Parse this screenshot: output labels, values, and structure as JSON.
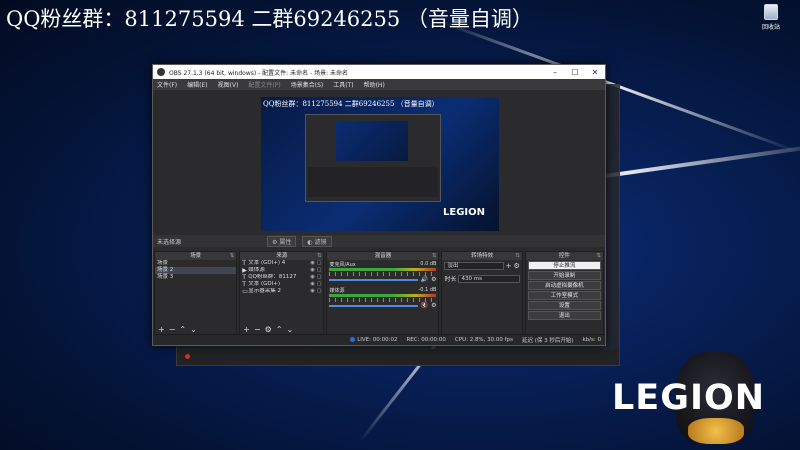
{
  "banner": {
    "text": "QQ粉丝群：811275594 二群69246255 （音量自调）"
  },
  "desktop": {
    "recycle_label": "回收站",
    "legion_logo": "LEGION"
  },
  "obs": {
    "title": "OBS 27.1.3 (64 bit, windows) - 配置文件: 未命名 - 场景: 未命名",
    "menu": [
      {
        "label": "文件(F)",
        "dim": false
      },
      {
        "label": "编辑(E)",
        "dim": false
      },
      {
        "label": "视图(V)",
        "dim": false
      },
      {
        "label": "配置文件(P)",
        "dim": true
      },
      {
        "label": "场景集合(S)",
        "dim": false
      },
      {
        "label": "工具(T)",
        "dim": false
      },
      {
        "label": "帮助(H)",
        "dim": false
      }
    ],
    "preview": {
      "text": "QQ粉丝群：811275594 二群69246255 （音量自调）",
      "logo": "LEGION"
    },
    "preview_toolbar": {
      "source_label": "未选择源",
      "props_label": "属性",
      "filters_label": "滤镜"
    },
    "scenes": {
      "header": "场景",
      "items": [
        "场景",
        "场景 2",
        "场景 3"
      ]
    },
    "sources": {
      "header": "来源",
      "items": [
        {
          "icon": "T",
          "label": "文本 (GDI+) 4"
        },
        {
          "icon": "▶",
          "label": "媒体源"
        },
        {
          "icon": "T",
          "label": "QQ粉丝群：81127"
        },
        {
          "icon": "T",
          "label": "文本 (GDI+)"
        },
        {
          "icon": "▭",
          "label": "显示器采集 2"
        }
      ]
    },
    "mixer": {
      "header": "混音器",
      "channels": [
        {
          "name": "麦克风/Aux",
          "db": "0.0 dB",
          "muted": false
        },
        {
          "name": "媒体源",
          "db": "-0.1 dB",
          "muted": true
        }
      ]
    },
    "transitions": {
      "header": "转场特效",
      "type": "淡出",
      "duration_label": "时长",
      "duration_value": "430 ms"
    },
    "controls": {
      "header": "控件",
      "buttons": [
        "停止推流",
        "开始录制",
        "启动虚拟摄像机",
        "工作室模式",
        "设置",
        "退出"
      ]
    },
    "status": {
      "live": "LIVE: 00:00:02",
      "rec": "REC: 00:00:00",
      "cpu": "CPU: 2.8%, 30.00 fps",
      "dropped": "延迟 (保 3 秒后开始)",
      "kbps": "kb/s: 0"
    }
  },
  "colors": {
    "accent": "#2a6fd6",
    "panel": "#2b2b2e",
    "muted": "#d33"
  }
}
